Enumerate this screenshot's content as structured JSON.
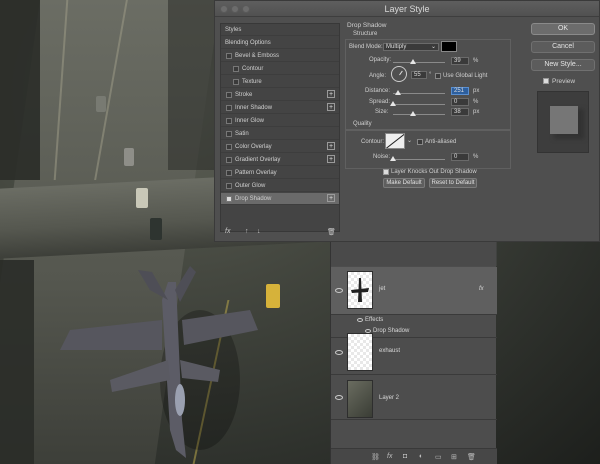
{
  "dialog": {
    "title": "Layer Style",
    "styles_list": [
      {
        "label": "Styles",
        "type": "plain",
        "selected": false
      },
      {
        "label": "Blending Options",
        "type": "plain",
        "selected": false
      },
      {
        "label": "Bevel & Emboss",
        "type": "check",
        "checked": false
      },
      {
        "label": "Contour",
        "type": "sub",
        "checked": false
      },
      {
        "label": "Texture",
        "type": "sub",
        "checked": false
      },
      {
        "label": "Stroke",
        "type": "check",
        "checked": false,
        "plus": true
      },
      {
        "label": "Inner Shadow",
        "type": "check",
        "checked": false,
        "plus": true
      },
      {
        "label": "Inner Glow",
        "type": "check",
        "checked": false
      },
      {
        "label": "Satin",
        "type": "check",
        "checked": false
      },
      {
        "label": "Color Overlay",
        "type": "check",
        "checked": false,
        "plus": true
      },
      {
        "label": "Gradient Overlay",
        "type": "check",
        "checked": false,
        "plus": true
      },
      {
        "label": "Pattern Overlay",
        "type": "check",
        "checked": false
      },
      {
        "label": "Outer Glow",
        "type": "check",
        "checked": false
      },
      {
        "label": "Drop Shadow",
        "type": "check",
        "checked": true,
        "plus": true,
        "selected": true
      }
    ],
    "fx_label": "fx",
    "section_title": "Drop Shadow",
    "structure_label": "Structure",
    "blend_mode_label": "Blend Mode:",
    "blend_mode_value": "Multiply",
    "shadow_color": "#000000",
    "opacity_label": "Opacity:",
    "opacity_value": "39",
    "opacity_level": 39,
    "angle_label": "Angle:",
    "angle_value": "55",
    "angle_unit": "°",
    "use_global_light_label": "Use Global Light",
    "distance_label": "Distance:",
    "distance_value": "251",
    "distance_level": 251,
    "distance_max": 30000,
    "spread_label": "Spread:",
    "spread_value": "0",
    "spread_level": 0,
    "size_label": "Size:",
    "size_value": "38",
    "size_level": 38,
    "size_max": 250,
    "unit_px": "px",
    "unit_pct": "%",
    "quality_label": "Quality",
    "contour_label": "Contour:",
    "anti_aliased_label": "Anti-aliased",
    "noise_label": "Noise:",
    "noise_value": "0",
    "noise_level": 0,
    "knockout_label": "Layer Knocks Out Drop Shadow",
    "make_default_label": "Make Default",
    "reset_default_label": "Reset to Default",
    "ok_label": "OK",
    "cancel_label": "Cancel",
    "new_style_label": "New Style...",
    "preview_label": "Preview"
  },
  "layers": [
    {
      "name": "jet",
      "fx": "fx",
      "effects_label": "Effects",
      "effect": "Drop Shadow"
    },
    {
      "name": "exhaust"
    },
    {
      "name": "Layer 2"
    }
  ]
}
